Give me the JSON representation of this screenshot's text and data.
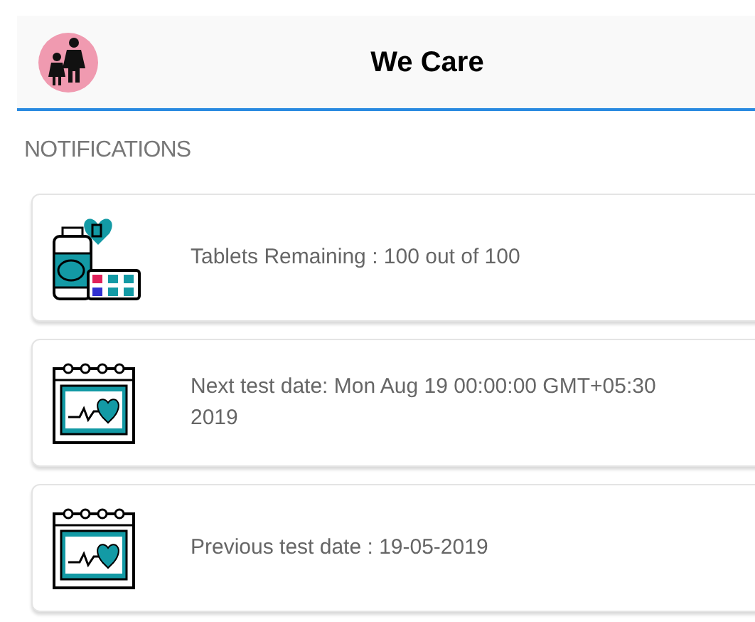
{
  "header": {
    "title": "We Care"
  },
  "section_title": "NOTIFICATIONS",
  "notifications": [
    {
      "kind": "medicine",
      "text": "Tablets Remaining : 100 out of 100"
    },
    {
      "kind": "calendar",
      "text": "Next test date: Mon Aug 19 00:00:00 GMT+05:30 2019"
    },
    {
      "kind": "calendar",
      "text": "Previous test date : 19-05-2019"
    }
  ]
}
